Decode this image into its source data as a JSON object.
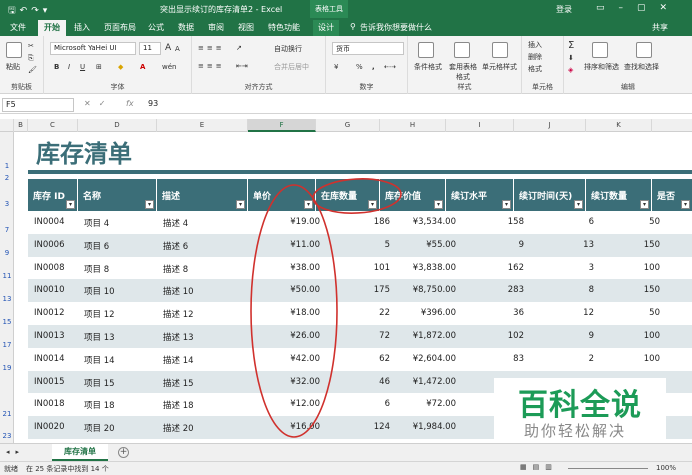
{
  "titlebar": {
    "title": "突出显示续订的库存清单2 - Excel",
    "table_tools": "表格工具",
    "login": "登录"
  },
  "tabs": [
    "文件",
    "开始",
    "插入",
    "页面布局",
    "公式",
    "数据",
    "审阅",
    "视图",
    "特色功能",
    "设计"
  ],
  "active_tab": "开始",
  "tell_me": "告诉我你想要做什么",
  "share": "共享",
  "ribbon": {
    "clipboard": {
      "paste": "粘贴",
      "label": "剪贴板"
    },
    "font": {
      "name": "Microsoft YaHei UI",
      "size": "11",
      "label": "字体",
      "increase": "A",
      "decrease": "A"
    },
    "alignment": {
      "wrap": "自动换行",
      "merge": "合并后居中",
      "label": "对齐方式"
    },
    "number": {
      "format": "货币",
      "label": "数字",
      "percent": "%",
      "comma": ",",
      "currency_symbol": "¥"
    },
    "styles": {
      "conditional": "条件格式",
      "table_format": "套用表格格式",
      "cell_styles": "单元格样式",
      "label": "样式"
    },
    "cells": {
      "insert": "插入",
      "delete": "删除",
      "format": "格式",
      "label": "单元格"
    },
    "editing": {
      "sort": "排序和筛选",
      "find": "查找和选择",
      "label": "编辑"
    }
  },
  "formula": {
    "namebox": "F5",
    "fx": "fx",
    "value": "93"
  },
  "columns": [
    "B",
    "C",
    "D",
    "E",
    "F",
    "G",
    "H",
    "I",
    "J",
    "K"
  ],
  "row_numbers": [
    "1",
    "2",
    "3",
    "7",
    "9",
    "11",
    "13",
    "15",
    "17",
    "19",
    "21",
    "23"
  ],
  "sheet_title": "库存清单",
  "headers": [
    "库存 ID",
    "名称",
    "描述",
    "单价",
    "在库数量",
    "库存价值",
    "续订水平",
    "续订时间(天)",
    "续订数量",
    "是否"
  ],
  "rows": [
    [
      "IN0004",
      "项目 4",
      "描述 4",
      "¥19.00",
      "186",
      "¥3,534.00",
      "158",
      "6",
      "50"
    ],
    [
      "IN0006",
      "项目 6",
      "描述 6",
      "¥11.00",
      "5",
      "¥55.00",
      "9",
      "13",
      "150"
    ],
    [
      "IN0008",
      "项目 8",
      "描述 8",
      "¥38.00",
      "101",
      "¥3,838.00",
      "162",
      "3",
      "100"
    ],
    [
      "IN0010",
      "项目 10",
      "描述 10",
      "¥50.00",
      "175",
      "¥8,750.00",
      "283",
      "8",
      "150"
    ],
    [
      "IN0012",
      "项目 12",
      "描述 12",
      "¥18.00",
      "22",
      "¥396.00",
      "36",
      "12",
      "50"
    ],
    [
      "IN0013",
      "项目 13",
      "描述 13",
      "¥26.00",
      "72",
      "¥1,872.00",
      "102",
      "9",
      "100"
    ],
    [
      "IN0014",
      "项目 14",
      "描述 14",
      "¥42.00",
      "62",
      "¥2,604.00",
      "83",
      "2",
      "100"
    ],
    [
      "IN0015",
      "项目 15",
      "描述 15",
      "¥32.00",
      "46",
      "¥1,472.00",
      "",
      "",
      ""
    ],
    [
      "IN0018",
      "项目 18",
      "描述 18",
      "¥12.00",
      "6",
      "¥72.00",
      "",
      "",
      ""
    ],
    [
      "IN0020",
      "项目 20",
      "描述 20",
      "¥16.00",
      "124",
      "¥1,984.00",
      "",
      "",
      ""
    ]
  ],
  "sheet_tab": "库存清单",
  "status": {
    "mode": "就绪",
    "message": "在 25 条记录中找到 14 个",
    "zoom": "100%"
  },
  "watermark": {
    "line1": "百科全说",
    "line2": "助你轻松解决"
  },
  "colors": {
    "excel_green": "#217346",
    "header_teal": "#3b6e78",
    "alt_row": "#dfe7ea",
    "annotation": "#d0312d"
  }
}
